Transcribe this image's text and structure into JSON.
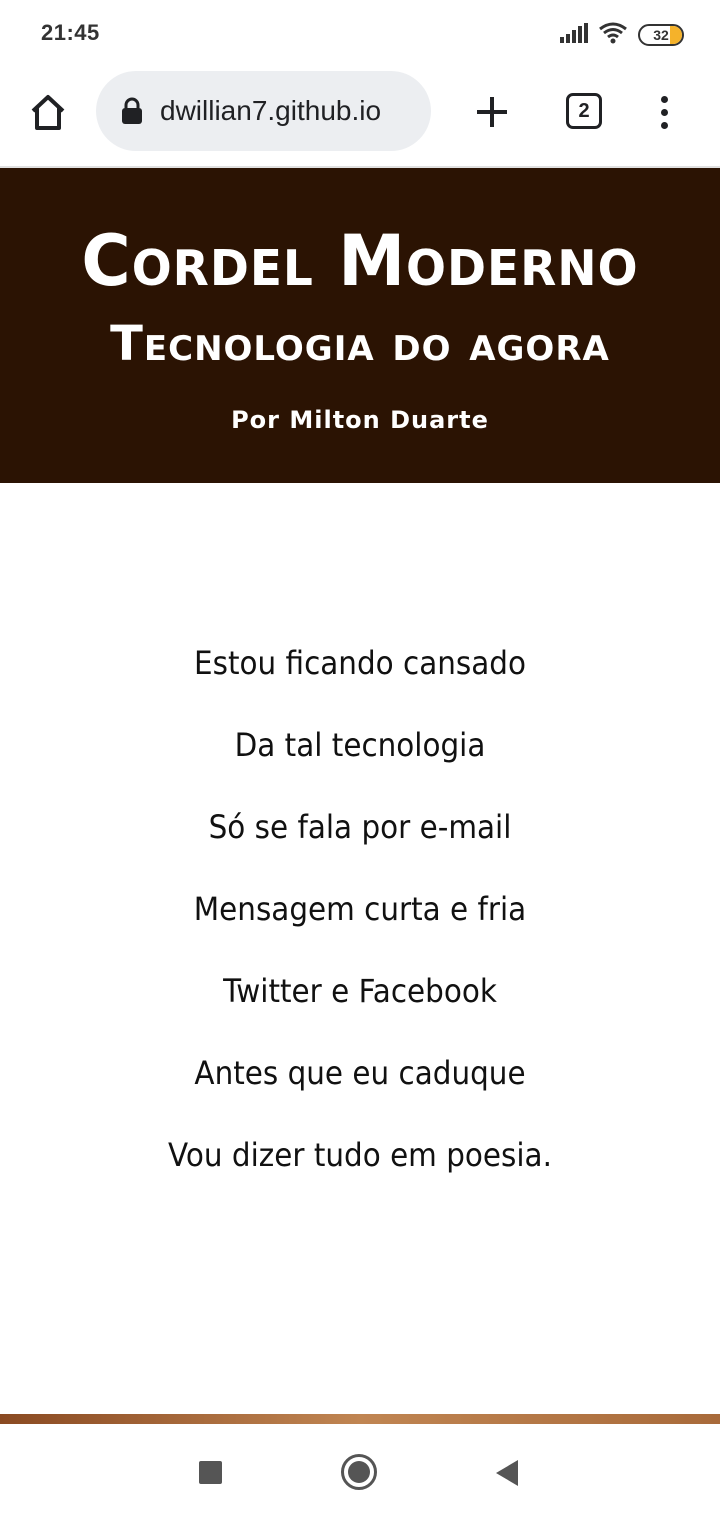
{
  "status_bar": {
    "time": "21:45",
    "battery_level": "32",
    "icons": [
      "signal-icon",
      "wifi-icon",
      "battery-icon"
    ],
    "battery_color": "#f5b22a"
  },
  "browser": {
    "url": "dwillian7.github.io",
    "tab_count": "2",
    "icons": [
      "home-icon",
      "lock-icon",
      "new-tab-icon",
      "tabs-icon",
      "menu-icon"
    ]
  },
  "header": {
    "title": "Cordel Moderno",
    "subtitle": "Tecnologia do agora",
    "author": "Por Milton Duarte",
    "background_color": "#2b1303"
  },
  "poem": {
    "lines": [
      "Estou ficando cansado",
      "Da tal tecnologia",
      "Só se fala por e-mail",
      "Mensagem curta e fria",
      "Twitter e Facebook",
      "Antes que eu caduque",
      "Vou dizer tudo em poesia."
    ]
  },
  "nav_bar": {
    "icons": [
      "recents-icon",
      "home-circle-icon",
      "back-icon"
    ]
  }
}
